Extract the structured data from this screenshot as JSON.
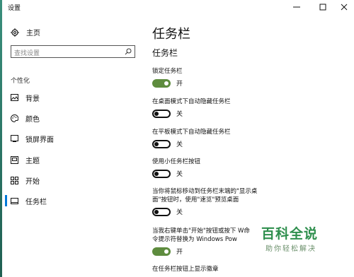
{
  "window": {
    "title": "设置",
    "controls": {
      "minimize": "minimize-icon",
      "maximize": "maximize-icon",
      "close": "close-icon"
    }
  },
  "sidebar": {
    "home_label": "主页",
    "search_placeholder": "查找设置",
    "section_label": "个性化",
    "items": [
      {
        "label": "背景",
        "icon": "picture-icon"
      },
      {
        "label": "颜色",
        "icon": "palette-icon"
      },
      {
        "label": "锁屏界面",
        "icon": "lock-screen-icon"
      },
      {
        "label": "主题",
        "icon": "theme-icon"
      },
      {
        "label": "开始",
        "icon": "start-icon"
      },
      {
        "label": "任务栏",
        "icon": "taskbar-icon",
        "active": true
      }
    ]
  },
  "content": {
    "page_title": "任务栏",
    "section_title": "任务栏",
    "settings": [
      {
        "label": "锁定任务栏",
        "state": "on",
        "state_text": "开"
      },
      {
        "label": "在桌面模式下自动隐藏任务栏",
        "state": "off",
        "state_text": "关"
      },
      {
        "label": "在平板模式下自动隐藏任务栏",
        "state": "off",
        "state_text": "关"
      },
      {
        "label": "使用小任务栏按钮",
        "state": "off",
        "state_text": "关"
      },
      {
        "label": "当你将鼠标移动到任务栏末端的\"显示桌面\"按钮时，使用\"速览\"预览桌面",
        "state": "off",
        "state_text": "关"
      },
      {
        "label": "当我右键单击\"开始\"按钮或按下 W命令提示符替换为 Windows Pow",
        "state": "on",
        "state_text": "开"
      },
      {
        "label": "在任务栏按钮上显示徽章"
      }
    ]
  },
  "watermark": {
    "brand": "百科全说",
    "tagline": "助你轻松解决"
  },
  "colors": {
    "toggle_on": "#5e8c3e",
    "accent": "#0078d7",
    "desktop": "#2d7a6a",
    "watermark": "#2f8f4e"
  }
}
